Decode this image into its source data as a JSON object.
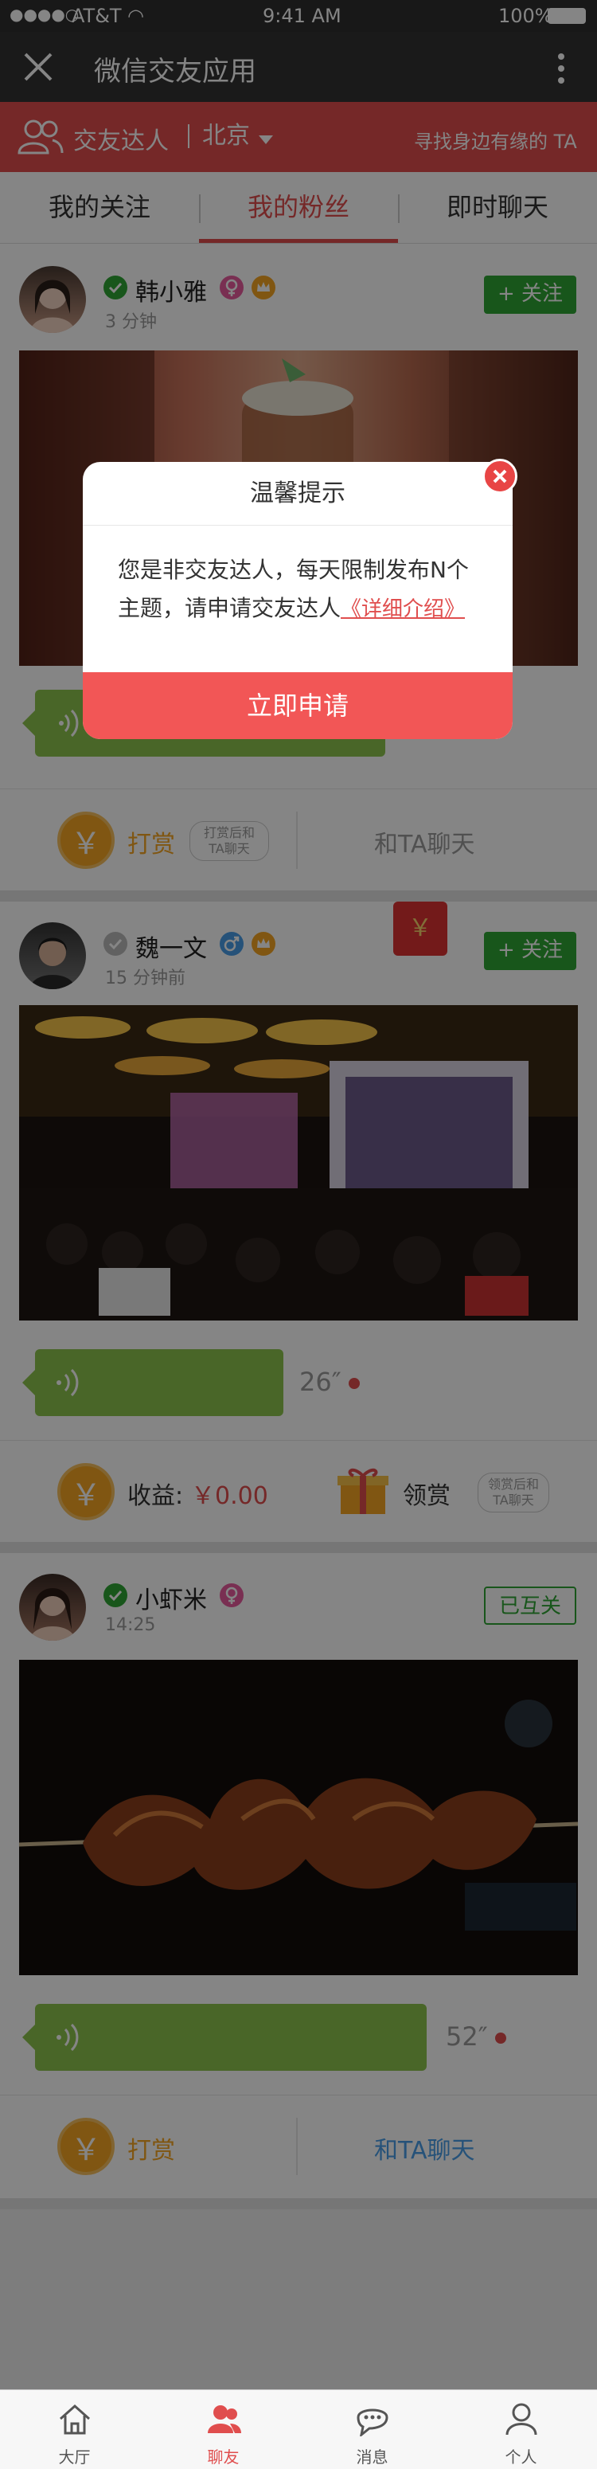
{
  "status_bar": {
    "carrier": "AT&T",
    "time": "9:41 AM",
    "battery": "100%"
  },
  "nav": {
    "title": "微信交友应用",
    "close_icon": "close-icon",
    "more_icon": "more-vertical-icon"
  },
  "red_bar": {
    "role_label": "交友达人",
    "city": "北京",
    "find_link": "寻找身边有缘的 TA"
  },
  "tabs": [
    {
      "label": "我的关注"
    },
    {
      "label": "我的粉丝"
    },
    {
      "label": "即时聊天"
    }
  ],
  "posts": [
    {
      "name": "韩小雅",
      "time": "3 分钟",
      "gender": "female",
      "follow_label": "+ 关注",
      "voice_duration": "",
      "action_left_label": "打赏",
      "action_left_note": "打赏后和TA聊天",
      "action_right_label": "和TA聊天"
    },
    {
      "name": "魏一文",
      "time": "15 分钟前",
      "gender": "male",
      "follow_label": "+ 关注",
      "voice_duration": "26″",
      "action_left_label": "收益:",
      "action_left_value": "￥0.00",
      "action_right_label": "领赏",
      "action_right_note": "领赏后和TA聊天"
    },
    {
      "name": "小虾米",
      "time": "14:25",
      "gender": "female",
      "follow_label": "已互关",
      "voice_duration": "52″",
      "action_left_label": "打赏",
      "action_right_label": "和TA聊天"
    }
  ],
  "red_packet_symbol": "￥",
  "modal": {
    "title": "温馨提示",
    "body": "您是非交友达人，每天限制发布N个主题，请申请交友达人",
    "link": "《详细介绍》",
    "button": "立即申请"
  },
  "tabbar": [
    {
      "label": "大厅",
      "icon": "home-icon"
    },
    {
      "label": "聊友",
      "icon": "friends-icon"
    },
    {
      "label": "消息",
      "icon": "message-icon"
    },
    {
      "label": "个人",
      "icon": "person-icon"
    }
  ],
  "colors": {
    "brand_red": "#e04e4e",
    "follow_green": "#2fa534",
    "voice_green": "#8dc44e",
    "coin_orange": "#f5a623"
  }
}
